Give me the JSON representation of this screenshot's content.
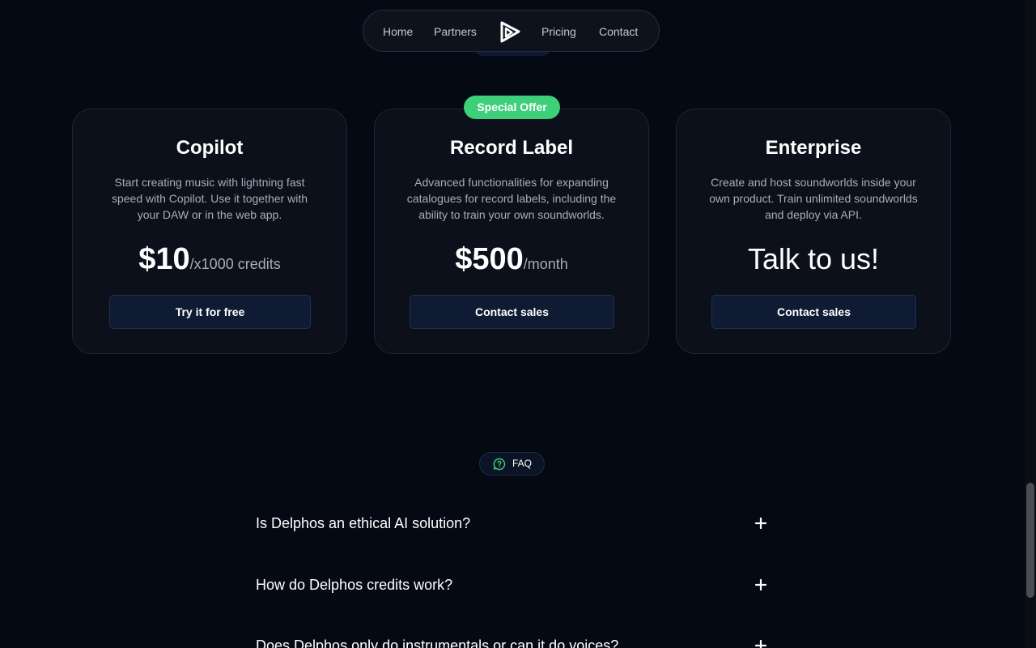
{
  "nav": {
    "links": {
      "home": "Home",
      "partners": "Partners",
      "pricing": "Pricing",
      "contact": "Contact"
    },
    "logo_icon": "play-triangle-logo-icon"
  },
  "pricing": {
    "badge": "Special Offer",
    "plans": [
      {
        "title": "Copilot",
        "description": "Start creating music with lightning fast speed with Copilot. Use it together with your DAW or in the web app.",
        "price": "$10",
        "price_unit": "/x1000 credits",
        "button": "Try it for free"
      },
      {
        "title": "Record Label",
        "description": "Advanced functionalities for expanding catalogues for record labels, including the ability to train your own soundworlds.",
        "price": "$500",
        "price_unit": "/month",
        "button": "Contact sales"
      },
      {
        "title": "Enterprise",
        "description": "Create and host soundworlds inside your own product. Train unlimited soundworlds and deploy via API.",
        "price_text": "Talk to us!",
        "button": "Contact sales"
      }
    ]
  },
  "faq": {
    "label": "FAQ",
    "icon": "chat-question-icon",
    "questions": [
      "Is Delphos an ethical AI solution?",
      "How do Delphos credits work?",
      "Does Delphos only do instrumentals or can it do voices?"
    ]
  },
  "colors": {
    "background": "#050914",
    "card": "#0b101b",
    "accent_green": "#3ecf7a",
    "button": "#0e1b33"
  }
}
